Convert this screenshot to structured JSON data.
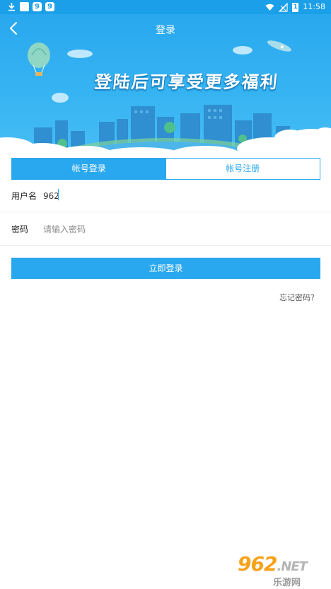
{
  "status_bar": {
    "notif_icons": [
      "download-icon",
      "square-icon",
      "nine-badge-icon",
      "nine-badge-icon"
    ],
    "badge_text": "9",
    "battery_text": "1",
    "time": "11:58"
  },
  "header": {
    "title": "登录",
    "slogan": "登陆后可享受更多福利"
  },
  "tabs": [
    {
      "label": "帐号登录",
      "active": true
    },
    {
      "label": "帐号注册",
      "active": false
    }
  ],
  "form": {
    "username_label": "用户名",
    "username_value": "962",
    "password_label": "密码",
    "password_placeholder": "请输入密码"
  },
  "login_button": "立即登录",
  "forgot_link": "忘记密码？",
  "watermark": {
    "top": "962",
    "suffix": ".NET",
    "bottom": "乐游网"
  },
  "colors": {
    "accent": "#2aa8ef",
    "status_bar": "#1a9fe8"
  }
}
